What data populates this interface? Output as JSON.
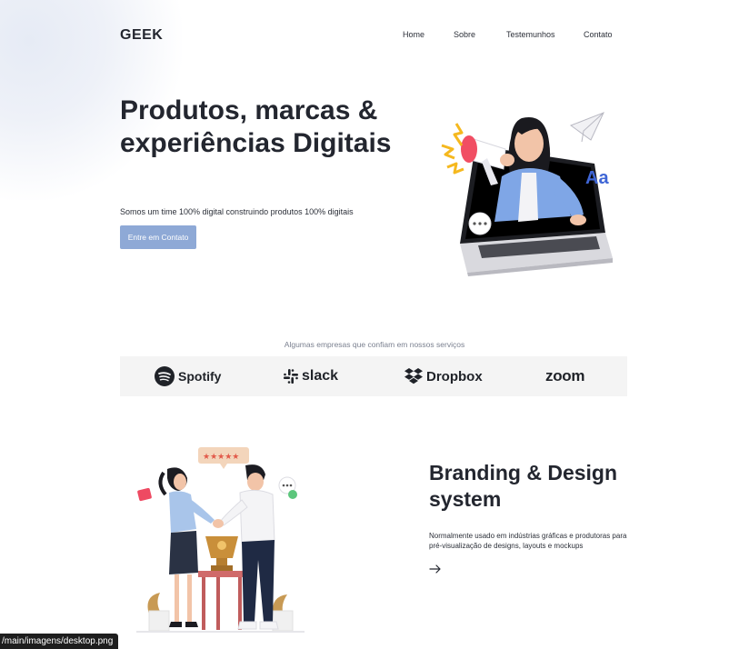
{
  "header": {
    "logo": "GEEK",
    "nav": [
      {
        "label": "Home"
      },
      {
        "label": "Sobre"
      },
      {
        "label": "Testemunhos"
      },
      {
        "label": "Contato"
      }
    ]
  },
  "hero": {
    "title": "Produtos, marcas & experiências Digitais",
    "subtitle": "Somos um time 100% digital construindo produtos 100% digitais",
    "cta_label": "Entre em Contato",
    "illustration_text": "Aa"
  },
  "brands": {
    "caption": "Algumas empresas que confiam em nossos serviços",
    "items": [
      {
        "name": "Spotify",
        "icon": "spotify-icon"
      },
      {
        "name": "slack",
        "icon": "slack-icon"
      },
      {
        "name": "Dropbox",
        "icon": "dropbox-icon"
      },
      {
        "name": "zoom",
        "icon": null
      }
    ]
  },
  "branding": {
    "title": "Branding & Design system",
    "text": "Normalmente usado em indústrias gráficas e produtoras para pré-visualização de designs, layouts e mockups",
    "arrow_icon": "arrow-right-icon"
  },
  "statusbar": {
    "url": "/main/imagens/desktop.png"
  },
  "colors": {
    "cta": "#8ea9d6",
    "text": "#23262f",
    "strip": "#f4f4f4"
  }
}
